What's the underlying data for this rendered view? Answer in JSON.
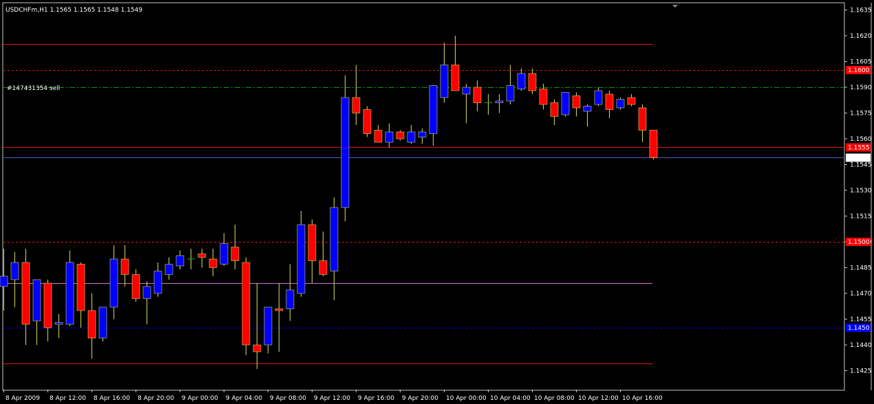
{
  "header": {
    "symbol_info": "USDCHFm,H1  1.1565 1.1565 1.1548 1.1549",
    "order_label": "#147431354 sell"
  },
  "colors": {
    "background": "#000000",
    "bull_body": "#0000ff",
    "bear_body": "#ff0000",
    "doji": "#00c000",
    "wick": "#d8d860",
    "resistance": "#e01818",
    "bid_line": "#4060c0",
    "order_line": "#00a000",
    "pivot_line": "#d070d0"
  },
  "chart_data": {
    "type": "candlestick",
    "symbol": "USDCHFm",
    "timeframe": "H1",
    "ohlc_current": {
      "open": 1.1565,
      "high": 1.1565,
      "low": 1.1548,
      "close": 1.1549
    },
    "ylim": [
      1.1418,
      1.164
    ],
    "y_ticks": [
      "1.1635",
      "1.1620",
      "1.1605",
      "1.1590",
      "1.1575",
      "1.1560",
      "1.1545",
      "1.1530",
      "1.1515",
      "1.1500",
      "1.1485",
      "1.1470",
      "1.1455",
      "1.1440",
      "1.1425"
    ],
    "x_labels": [
      "8 Apr 2009",
      "8 Apr 12:00",
      "8 Apr 16:00",
      "8 Apr 20:00",
      "9 Apr 00:00",
      "9 Apr 04:00",
      "9 Apr 08:00",
      "9 Apr 12:00",
      "9 Apr 16:00",
      "9 Apr 20:00",
      "10 Apr 00:00",
      "10 Apr 04:00",
      "10 Apr 08:00",
      "10 Apr 12:00",
      "10 Apr 16:00"
    ],
    "price_tags": [
      {
        "text": "1.1600",
        "value": 1.16,
        "color": "#ff0000"
      },
      {
        "text": "1.1555",
        "value": 1.1555,
        "color": "#ff0000"
      },
      {
        "text": "1.1549",
        "value": 1.1549,
        "color": "#ffffff"
      },
      {
        "text": "1.1500",
        "value": 1.15,
        "color": "#ff0000"
      },
      {
        "text": "1.1450",
        "value": 1.145,
        "color": "#0000ff"
      }
    ],
    "hlines": [
      {
        "value": 1.1615,
        "style": "solid",
        "color": "#e01818",
        "extends": false
      },
      {
        "value": 1.16,
        "style": "dashed",
        "color": "#e01818",
        "extends": true
      },
      {
        "value": 1.159,
        "style": "dashdot",
        "color": "#00a000",
        "extends": true
      },
      {
        "value": 1.1555,
        "style": "solid",
        "color": "#e01818",
        "extends": true
      },
      {
        "value": 1.1549,
        "style": "solid",
        "color": "#4060c0",
        "extends": true
      },
      {
        "value": 1.15,
        "style": "dashed",
        "color": "#e01818",
        "extends": true
      },
      {
        "value": 1.1476,
        "style": "solid",
        "color": "#d070d0",
        "extends": false
      },
      {
        "value": 1.145,
        "style": "dashed",
        "color": "#0000ff",
        "extends": true
      },
      {
        "value": 1.1429,
        "style": "solid",
        "color": "#e01818",
        "extends": false
      }
    ],
    "candles": [
      {
        "o": 1.1474,
        "h": 1.1496,
        "l": 1.146,
        "c": 1.148
      },
      {
        "o": 1.1478,
        "h": 1.1494,
        "l": 1.1462,
        "c": 1.1488
      },
      {
        "o": 1.1488,
        "h": 1.1496,
        "l": 1.144,
        "c": 1.1452
      },
      {
        "o": 1.1454,
        "h": 1.1478,
        "l": 1.144,
        "c": 1.1478
      },
      {
        "o": 1.1476,
        "h": 1.1478,
        "l": 1.1442,
        "c": 1.145
      },
      {
        "o": 1.1452,
        "h": 1.1458,
        "l": 1.1444,
        "c": 1.1453
      },
      {
        "o": 1.1452,
        "h": 1.1495,
        "l": 1.1451,
        "c": 1.1488
      },
      {
        "o": 1.1487,
        "h": 1.1488,
        "l": 1.145,
        "c": 1.146
      },
      {
        "o": 1.146,
        "h": 1.147,
        "l": 1.1432,
        "c": 1.1444
      },
      {
        "o": 1.1444,
        "h": 1.1462,
        "l": 1.1442,
        "c": 1.1462
      },
      {
        "o": 1.1462,
        "h": 1.1498,
        "l": 1.1455,
        "c": 1.149
      },
      {
        "o": 1.149,
        "h": 1.1498,
        "l": 1.1474,
        "c": 1.1481
      },
      {
        "o": 1.1481,
        "h": 1.1484,
        "l": 1.1465,
        "c": 1.1467
      },
      {
        "o": 1.1467,
        "h": 1.1477,
        "l": 1.1452,
        "c": 1.1474
      },
      {
        "o": 1.147,
        "h": 1.1488,
        "l": 1.1468,
        "c": 1.1483
      },
      {
        "o": 1.1481,
        "h": 1.1491,
        "l": 1.1478,
        "c": 1.1487
      },
      {
        "o": 1.1486,
        "h": 1.1495,
        "l": 1.1484,
        "c": 1.1492
      },
      {
        "o": 1.149,
        "h": 1.1496,
        "l": 1.1484,
        "c": 1.149
      },
      {
        "o": 1.1493,
        "h": 1.1496,
        "l": 1.1485,
        "c": 1.1491
      },
      {
        "o": 1.149,
        "h": 1.1496,
        "l": 1.148,
        "c": 1.1485
      },
      {
        "o": 1.1487,
        "h": 1.1505,
        "l": 1.1486,
        "c": 1.1499
      },
      {
        "o": 1.1497,
        "h": 1.151,
        "l": 1.1484,
        "c": 1.1489
      },
      {
        "o": 1.1488,
        "h": 1.1491,
        "l": 1.1434,
        "c": 1.144
      },
      {
        "o": 1.144,
        "h": 1.1476,
        "l": 1.1426,
        "c": 1.1436
      },
      {
        "o": 1.144,
        "h": 1.1462,
        "l": 1.1435,
        "c": 1.1462
      },
      {
        "o": 1.1461,
        "h": 1.1476,
        "l": 1.1436,
        "c": 1.146
      },
      {
        "o": 1.1461,
        "h": 1.1487,
        "l": 1.1454,
        "c": 1.1472
      },
      {
        "o": 1.147,
        "h": 1.1518,
        "l": 1.1468,
        "c": 1.151
      },
      {
        "o": 1.151,
        "h": 1.1513,
        "l": 1.1476,
        "c": 1.1489
      },
      {
        "o": 1.1489,
        "h": 1.1506,
        "l": 1.148,
        "c": 1.1481
      },
      {
        "o": 1.1483,
        "h": 1.1526,
        "l": 1.1466,
        "c": 1.152
      },
      {
        "o": 1.152,
        "h": 1.1597,
        "l": 1.1512,
        "c": 1.1584
      },
      {
        "o": 1.1584,
        "h": 1.1603,
        "l": 1.1568,
        "c": 1.1575
      },
      {
        "o": 1.1577,
        "h": 1.1579,
        "l": 1.1561,
        "c": 1.1563
      },
      {
        "o": 1.1565,
        "h": 1.1568,
        "l": 1.1558,
        "c": 1.1558
      },
      {
        "o": 1.1558,
        "h": 1.1569,
        "l": 1.1555,
        "c": 1.1564
      },
      {
        "o": 1.1564,
        "h": 1.1565,
        "l": 1.1559,
        "c": 1.156
      },
      {
        "o": 1.1558,
        "h": 1.1568,
        "l": 1.1557,
        "c": 1.1564
      },
      {
        "o": 1.1561,
        "h": 1.1566,
        "l": 1.1557,
        "c": 1.1564
      },
      {
        "o": 1.1563,
        "h": 1.1572,
        "l": 1.1556,
        "c": 1.1591
      },
      {
        "o": 1.1584,
        "h": 1.1616,
        "l": 1.1581,
        "c": 1.1603
      },
      {
        "o": 1.1603,
        "h": 1.162,
        "l": 1.1588,
        "c": 1.1588
      },
      {
        "o": 1.1586,
        "h": 1.1592,
        "l": 1.1569,
        "c": 1.159
      },
      {
        "o": 1.159,
        "h": 1.1594,
        "l": 1.1576,
        "c": 1.1581
      },
      {
        "o": 1.1581,
        "h": 1.1586,
        "l": 1.1574,
        "c": 1.1581
      },
      {
        "o": 1.1581,
        "h": 1.1586,
        "l": 1.1575,
        "c": 1.1582
      },
      {
        "o": 1.1582,
        "h": 1.1603,
        "l": 1.158,
        "c": 1.1591
      },
      {
        "o": 1.1589,
        "h": 1.1601,
        "l": 1.1588,
        "c": 1.1598
      },
      {
        "o": 1.1598,
        "h": 1.1601,
        "l": 1.1586,
        "c": 1.1588
      },
      {
        "o": 1.1589,
        "h": 1.1592,
        "l": 1.1577,
        "c": 1.158
      },
      {
        "o": 1.1581,
        "h": 1.1583,
        "l": 1.1568,
        "c": 1.1573
      },
      {
        "o": 1.1574,
        "h": 1.1587,
        "l": 1.1573,
        "c": 1.1587
      },
      {
        "o": 1.1585,
        "h": 1.1587,
        "l": 1.1573,
        "c": 1.1578
      },
      {
        "o": 1.1576,
        "h": 1.158,
        "l": 1.1567,
        "c": 1.1579
      },
      {
        "o": 1.158,
        "h": 1.159,
        "l": 1.1579,
        "c": 1.1588
      },
      {
        "o": 1.1586,
        "h": 1.1588,
        "l": 1.1572,
        "c": 1.1577
      },
      {
        "o": 1.1578,
        "h": 1.1584,
        "l": 1.1577,
        "c": 1.1583
      },
      {
        "o": 1.1584,
        "h": 1.1586,
        "l": 1.1579,
        "c": 1.158
      },
      {
        "o": 1.1578,
        "h": 1.158,
        "l": 1.1558,
        "c": 1.1565
      },
      {
        "o": 1.1565,
        "h": 1.1565,
        "l": 1.1548,
        "c": 1.1549
      }
    ]
  }
}
